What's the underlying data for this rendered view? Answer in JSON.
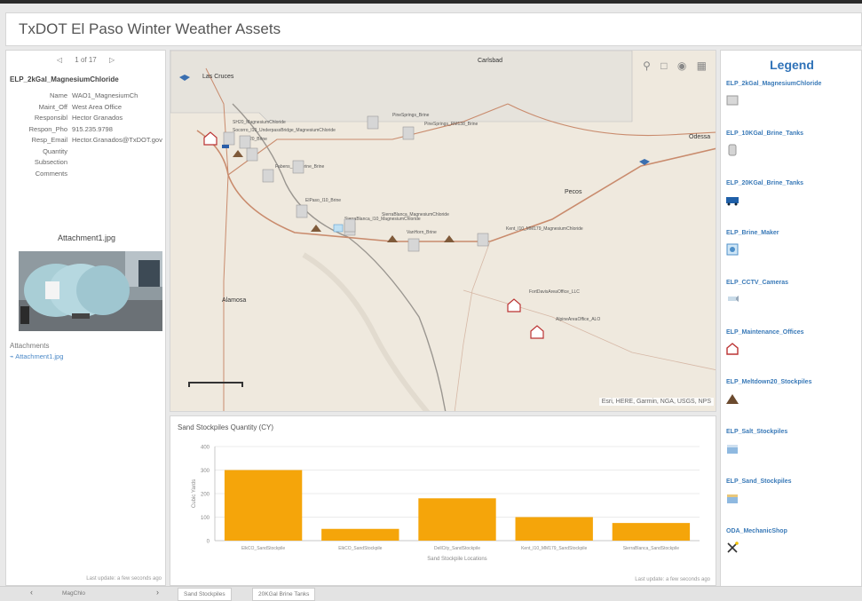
{
  "app": {
    "title": "TxDOT El Paso Winter Weather Assets"
  },
  "details": {
    "pager": {
      "prev": "◁",
      "text": "1 of 17",
      "next": "▷"
    },
    "feature_title": "ELP_2kGal_MagnesiumChloride",
    "attributes": [
      {
        "key": "Name",
        "value": "WAO1_MagnesiumCh"
      },
      {
        "key": "Maint_Off",
        "value": "West Area Office"
      },
      {
        "key": "Responsibl",
        "value": "Hector Granados"
      },
      {
        "key": "Respon_Pho",
        "value": "915.235.9798"
      },
      {
        "key": "Resp_Email",
        "value": "Hector.Granados@TxDOT.gov"
      },
      {
        "key": "Quantity",
        "value": ""
      },
      {
        "key": "Subsection",
        "value": ""
      },
      {
        "key": "Comments",
        "value": ""
      }
    ],
    "attachment_title": "Attachment1.jpg",
    "attachments_label": "Attachments",
    "attachment_link": "Attachment1.jpg",
    "last_update": "Last update: a few seconds ago"
  },
  "map": {
    "tools": [
      "search-icon",
      "square-icon",
      "globe-icon",
      "grid-icon"
    ],
    "attribution": "Esri, HERE, Garmin, NGA, USGS, NPS",
    "cities": [
      "Las Cruces",
      "Carlsbad",
      "Odessa",
      "Pecos",
      "Alamosa"
    ],
    "markers": [
      {
        "label": "SH20_MagnesiumChloride",
        "icon": "tank"
      },
      {
        "label": "Socorro_I10_UnderpassBridge_MagnesiumChloride",
        "icon": "tank"
      },
      {
        "label": "SH20_Brine",
        "icon": "tank"
      },
      {
        "label": "Fabens_I10_Brine_Brine",
        "icon": "tank"
      },
      {
        "label": "ElPaso_I10_Brine",
        "icon": "tank"
      },
      {
        "label": "SierraBlanca_I10_MagnesiumChloride",
        "icon": "tank"
      },
      {
        "label": "SierraBlanca_MagnesiumChloride",
        "icon": "tank"
      },
      {
        "label": "VanHorn_Brine",
        "icon": "tank"
      },
      {
        "label": "Kent_I10_MM179_MagnesiumChloride",
        "icon": "tank"
      },
      {
        "label": "FortDavisAreaOffice_LLC",
        "icon": "office"
      },
      {
        "label": "AlpineAreaOffice_ALO",
        "icon": "office"
      },
      {
        "label": "PineSprings_Brine",
        "icon": "tank"
      },
      {
        "label": "PineSprings_RM138_Brine",
        "icon": "tank"
      }
    ]
  },
  "chart_panel": {
    "last_update": "Last update: a few seconds ago"
  },
  "chart_data": {
    "type": "bar",
    "title": "Sand Stockpiles Quantity (CY)",
    "xlabel": "Sand Stockpile Locations",
    "ylabel": "Cubic Yards",
    "categories": [
      "ElkCO_SandStockpile",
      "ElkCO_SandStockpile",
      "DellCity_SandStockpile",
      "Kent_I10_MM179_SandStockpile",
      "SierraBlanca_SandStockpile"
    ],
    "values": [
      300,
      50,
      180,
      100,
      75
    ],
    "ylim": [
      0,
      400
    ],
    "yticks": [
      0,
      100,
      200,
      300,
      400
    ],
    "color": "#f5a50a",
    "grid": true
  },
  "legend": {
    "title": "Legend",
    "items": [
      {
        "name": "ELP_2kGal_MagnesiumChloride",
        "icon": "gray-tank-icon"
      },
      {
        "name": "ELP_10KGal_Brine_Tanks",
        "icon": "gray-cylinder-icon"
      },
      {
        "name": "ELP_20KGal_Brine_Tanks",
        "icon": "blue-truck-icon"
      },
      {
        "name": "ELP_Brine_Maker",
        "icon": "brine-maker-icon"
      },
      {
        "name": "ELP_CCTV_Cameras",
        "icon": "camera-icon"
      },
      {
        "name": "ELP_Maintenance_Offices",
        "icon": "office-icon"
      },
      {
        "name": "ELP_Meltdown20_Stockpiles",
        "icon": "mound-icon"
      },
      {
        "name": "ELP_Salt_Stockpiles",
        "icon": "salt-icon"
      },
      {
        "name": "ELP_Sand_Stockpiles",
        "icon": "sand-icon"
      },
      {
        "name": "ODA_MechanicShop",
        "icon": "wrench-icon"
      }
    ]
  },
  "bottom": {
    "nav_left": "‹",
    "nav_right": "›",
    "left_tab": "MagChlo",
    "tabs": [
      "Sand Stockpiles",
      "20KGal Brine Tanks"
    ]
  }
}
